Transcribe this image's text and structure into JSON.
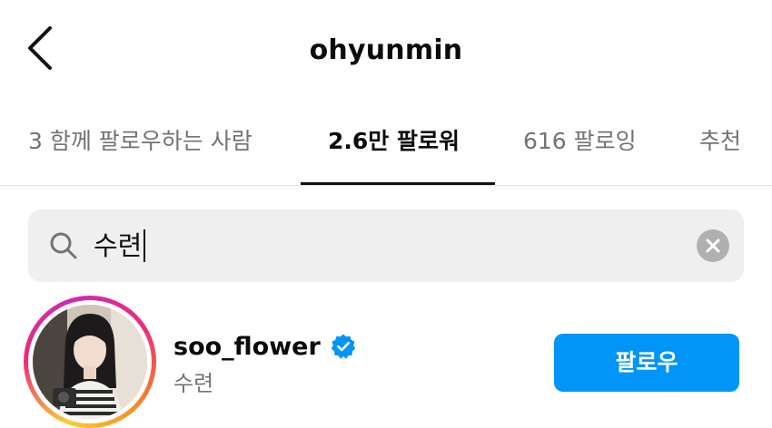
{
  "header": {
    "title": "ohyunmin",
    "back_icon": "chevron-left-icon"
  },
  "tabs": [
    {
      "label": "3 함께 팔로우하는 사람",
      "active": false
    },
    {
      "label": "2.6만 팔로워",
      "active": true
    },
    {
      "label": "616 팔로잉",
      "active": false
    },
    {
      "label": "추천",
      "active": false
    }
  ],
  "search": {
    "value": "수련",
    "icon": "search-icon",
    "clear_icon": "close-circle-icon"
  },
  "results": [
    {
      "username": "soo_flower",
      "verified": true,
      "full_name": "수련",
      "follow_label": "팔로우",
      "avatar": "profile-photo"
    }
  ],
  "colors": {
    "accent": "#0095f6",
    "text_primary": "#0b0b0b",
    "text_secondary": "#737373",
    "search_bg": "#efefef",
    "verified": "#0095f6"
  }
}
